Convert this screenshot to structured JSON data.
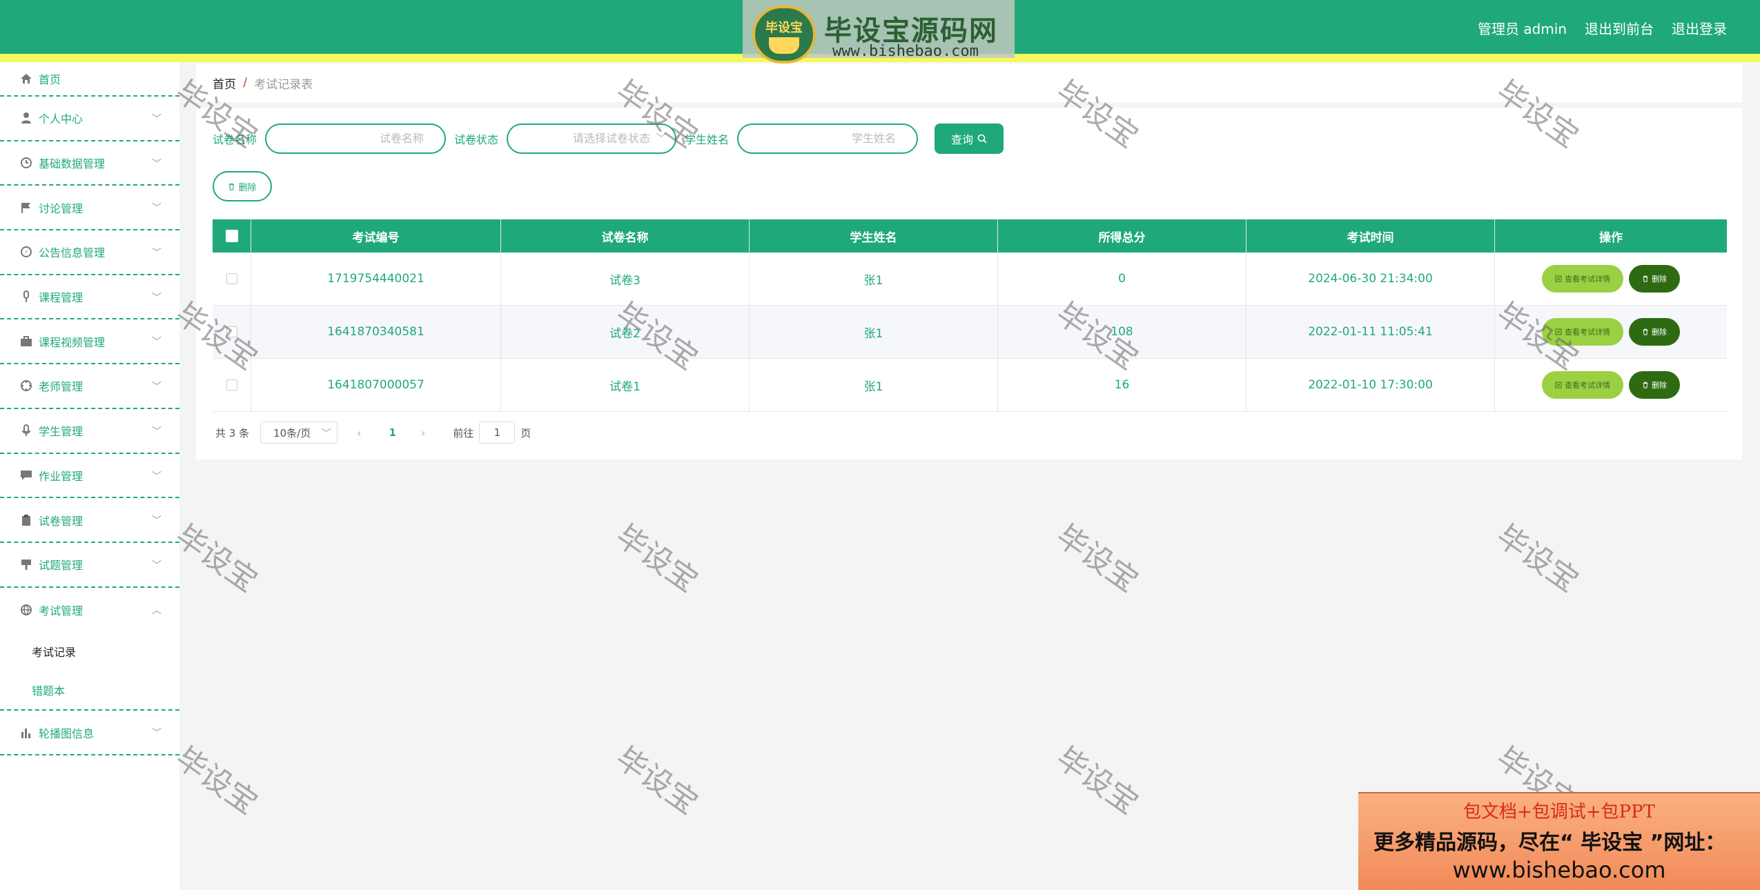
{
  "header": {
    "user_label": "管理员 admin",
    "to_front": "退出到前台",
    "logout": "退出登录"
  },
  "logo": {
    "emblem_text": "毕设宝",
    "title": "毕设宝源码网",
    "url": "www.bishebao.com"
  },
  "sidebar": {
    "items": [
      {
        "label": "首页",
        "icon": "home-icon"
      },
      {
        "label": "个人中心",
        "icon": "user-icon"
      },
      {
        "label": "基础数据管理",
        "icon": "clock-icon"
      },
      {
        "label": "讨论管理",
        "icon": "flag-icon"
      },
      {
        "label": "公告信息管理",
        "icon": "compass-icon"
      },
      {
        "label": "课程管理",
        "icon": "microphone-icon"
      },
      {
        "label": "课程视频管理",
        "icon": "briefcase-icon"
      },
      {
        "label": "老师管理",
        "icon": "target-icon"
      },
      {
        "label": "学生管理",
        "icon": "mic-icon"
      },
      {
        "label": "作业管理",
        "icon": "chat-icon"
      },
      {
        "label": "试卷管理",
        "icon": "clipboard-icon"
      },
      {
        "label": "试题管理",
        "icon": "pin-icon"
      },
      {
        "label": "考试管理",
        "icon": "globe-icon"
      }
    ],
    "submenu": [
      "考试记录",
      "错题本"
    ],
    "last_item": {
      "label": "轮播图信息",
      "icon": "bar-chart-icon"
    }
  },
  "breadcrumb": {
    "home": "首页",
    "sep": "/",
    "current": "考试记录表"
  },
  "search": {
    "paper_label": "试卷名称",
    "paper_placeholder": "试卷名称",
    "status_label": "试卷状态",
    "status_placeholder": "请选择试卷状态",
    "student_label": "学生姓名",
    "student_placeholder": "学生姓名",
    "query_button": "查询"
  },
  "toolbar": {
    "delete_label": "删除"
  },
  "table": {
    "headers": [
      "考试编号",
      "试卷名称",
      "学生姓名",
      "所得总分",
      "考试时间",
      "操作"
    ],
    "rows": [
      {
        "id": "1719754440021",
        "paper": "试卷3",
        "student": "张1",
        "score": "0",
        "time": "2024-06-30 21:34:00"
      },
      {
        "id": "1641870340581",
        "paper": "试卷2",
        "student": "张1",
        "score": "108",
        "time": "2022-01-11 11:05:41"
      },
      {
        "id": "1641807000057",
        "paper": "试卷1",
        "student": "张1",
        "score": "16",
        "time": "2022-01-10 17:30:00"
      }
    ],
    "view_button": "查看考试详情",
    "delete_button": "删除"
  },
  "pager": {
    "total": "共 3 条",
    "page_size": "10条/页",
    "current_page": "1",
    "goto_label": "前往",
    "goto_value": "1",
    "page_unit": "页"
  },
  "watermark": "毕设宝",
  "ad": {
    "line1": "包文档+包调试+包PPT",
    "line2": "更多精品源码，尽在“ 毕设宝 ”网址：",
    "line3": "www.bishebao.com"
  },
  "colors": {
    "primary": "#1fa97a",
    "stripe": "#f6f95e",
    "view_button": "#9bd043",
    "delete_button": "#2e6a12"
  }
}
